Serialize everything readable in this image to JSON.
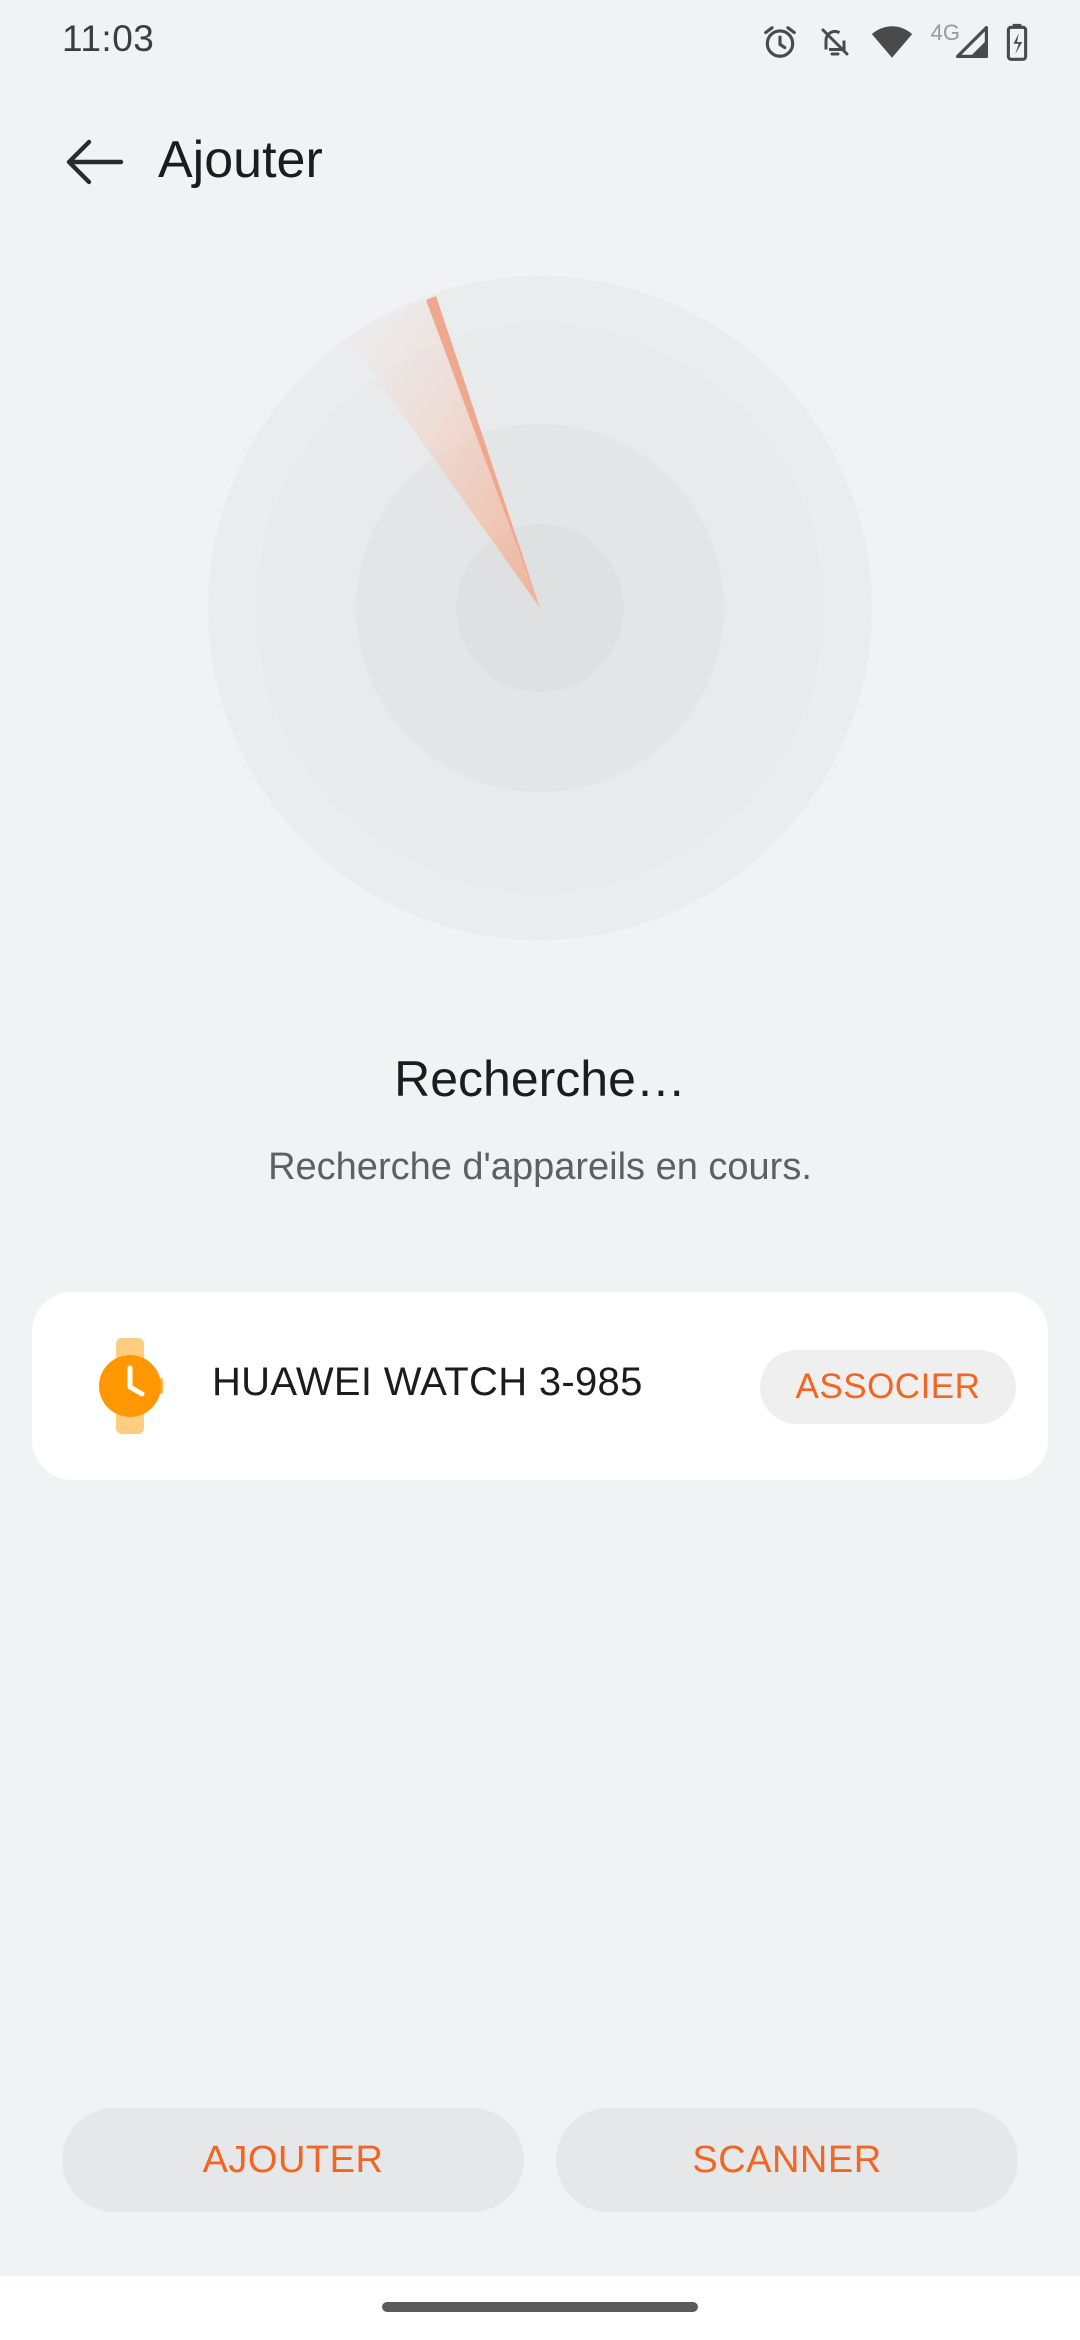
{
  "status_bar": {
    "time": "11:03",
    "network": "4G",
    "icons": [
      "alarm-icon",
      "notifications-off-icon",
      "wifi-icon",
      "cellular-signal-icon",
      "battery-charging-icon"
    ]
  },
  "header": {
    "back_icon": "arrow-left-icon",
    "title": "Ajouter"
  },
  "search": {
    "title": "Recherche…",
    "subtitle": "Recherche d'appareils en cours."
  },
  "devices": [
    {
      "icon": "smartwatch-icon",
      "name": "HUAWEI WATCH 3-985",
      "action_label": "ASSOCIER"
    }
  ],
  "actions": {
    "add_label": "AJOUTER",
    "scan_label": "SCANNER"
  },
  "colors": {
    "accent": "#f26522",
    "background": "#f1f2f4",
    "card": "#ffffff",
    "watch": "#ff9800"
  }
}
